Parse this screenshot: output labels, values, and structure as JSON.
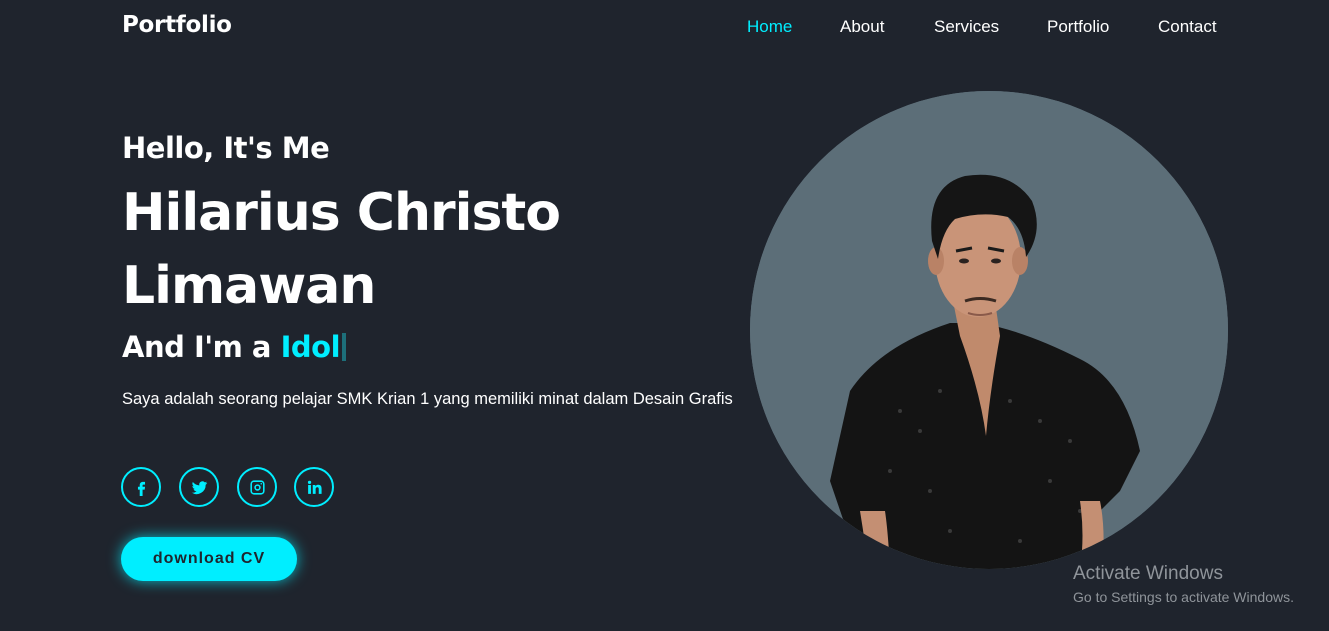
{
  "header": {
    "logo": "Portfolio",
    "nav": [
      "Home",
      "About",
      "Services",
      "Portfolio",
      "Contact"
    ],
    "active": "Home"
  },
  "home": {
    "greeting": "Hello, It's Me",
    "name": "Hilarius Christo Limawan",
    "role_prefix": "And I'm a ",
    "role_highlight": "Idol",
    "description": "Saya adalah seorang pelajar SMK Krian 1 yang memiliki minat dalam Desain Grafis",
    "socials": [
      "facebook-icon",
      "twitter-icon",
      "instagram-icon",
      "linkedin-icon"
    ],
    "button_label": "download CV",
    "profile_image": "profile-photo"
  },
  "colors": {
    "background": "#1f242d",
    "accent": "#00eeff",
    "text": "#ffffff",
    "image_bg": "#5c6e78"
  },
  "watermark": {
    "title": "Activate Windows",
    "subtitle": "Go to Settings to activate Windows."
  }
}
